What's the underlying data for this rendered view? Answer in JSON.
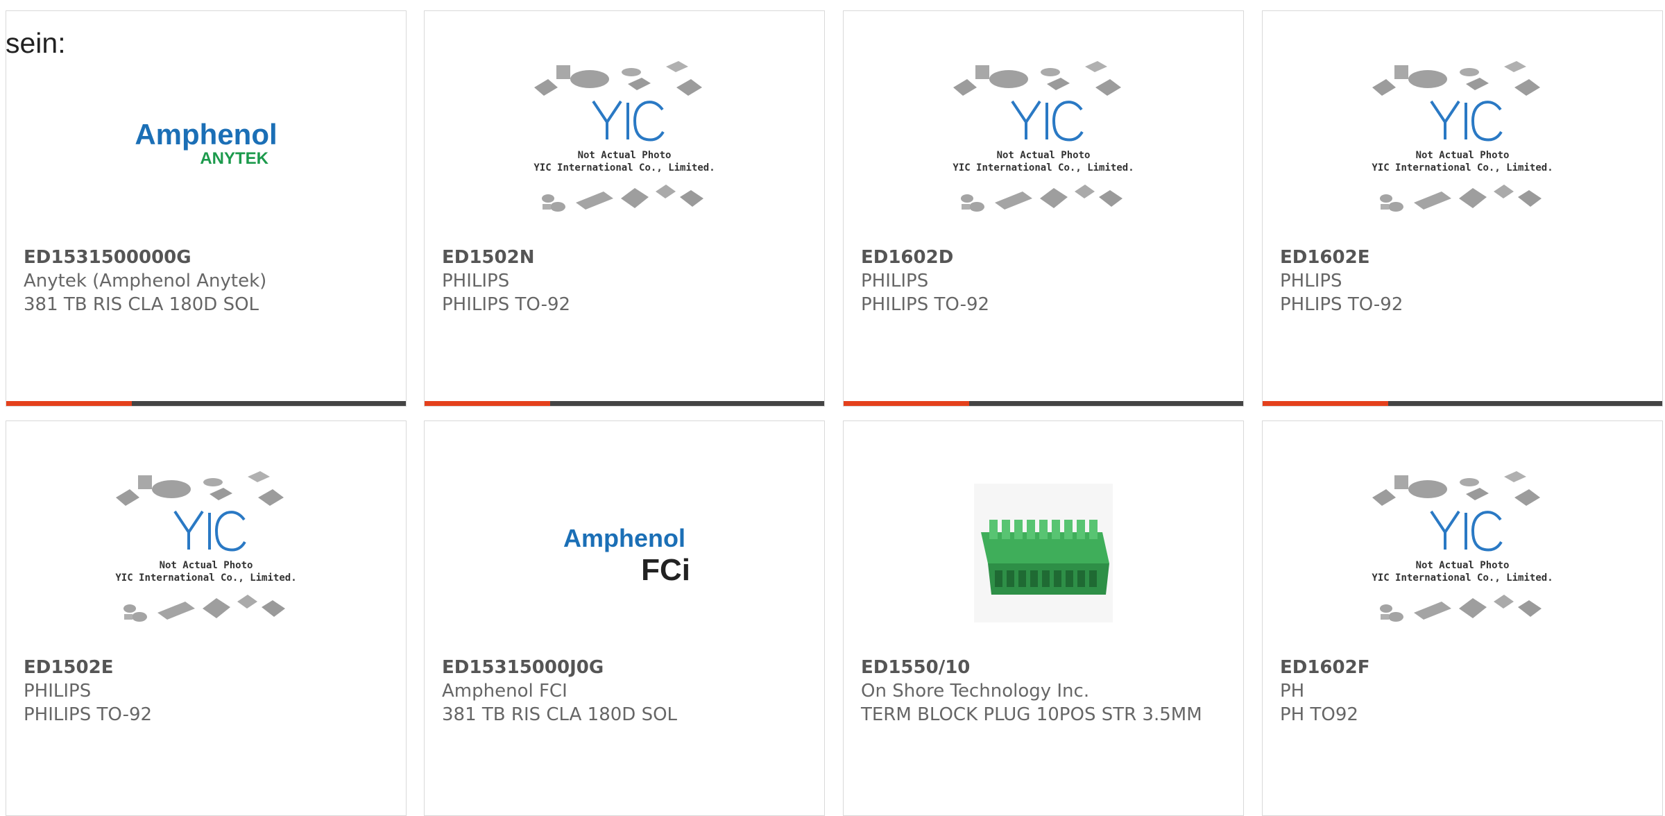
{
  "intro_text": "sein:",
  "colors": {
    "accent": "#e4401c",
    "bar": "#444444",
    "amphenol_blue": "#1b6fb6",
    "anytek_green": "#1c9a4c",
    "yic_blue": "#2a79c4"
  },
  "image_caption": {
    "line1": "Not Actual Photo",
    "line2": "YIC International Co., Limited."
  },
  "logos": {
    "amphenol_anytek": {
      "brand": "Amphenol",
      "sub": "ANYTEK"
    },
    "amphenol_fci": {
      "brand": "Amphenol",
      "sub": "FCi"
    },
    "yic": "YIC"
  },
  "products": [
    {
      "part_number": "ED1531500000G",
      "manufacturer": "Anytek (Amphenol Anytek)",
      "description": "381 TB RIS CLA 180D SOL",
      "image": "amphenol-anytek-logo"
    },
    {
      "part_number": "ED1502N",
      "manufacturer": "PHILIPS",
      "description": "PHILIPS TO-92",
      "image": "yic-placeholder"
    },
    {
      "part_number": "ED1602D",
      "manufacturer": "PHILIPS",
      "description": "PHILIPS TO-92",
      "image": "yic-placeholder"
    },
    {
      "part_number": "ED1602E",
      "manufacturer": "PHLIPS",
      "description": "PHLIPS TO-92",
      "image": "yic-placeholder"
    },
    {
      "part_number": "ED1502E",
      "manufacturer": "PHILIPS",
      "description": "PHILIPS TO-92",
      "image": "yic-placeholder"
    },
    {
      "part_number": "ED15315000J0G",
      "manufacturer": "Amphenol FCI",
      "description": "381 TB RIS CLA 180D SOL",
      "image": "amphenol-fci-logo"
    },
    {
      "part_number": "ED1550/10",
      "manufacturer": "On Shore Technology Inc.",
      "description": "TERM BLOCK PLUG 10POS STR 3.5MM",
      "image": "terminal-block-photo"
    },
    {
      "part_number": "ED1602F",
      "manufacturer": "PH",
      "description": "PH TO92",
      "image": "yic-placeholder"
    }
  ]
}
